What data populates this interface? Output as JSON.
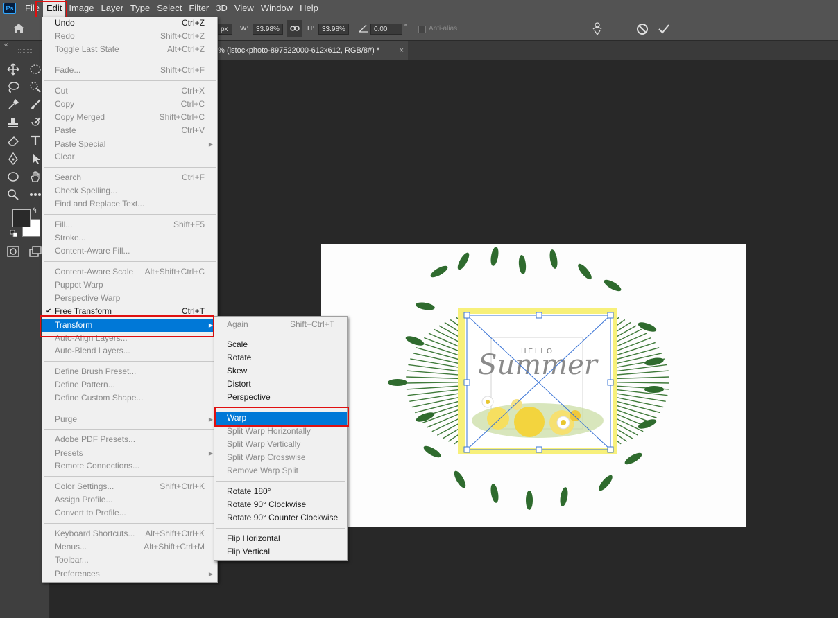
{
  "menubar": {
    "logo": "Ps",
    "items": [
      "File",
      "Edit",
      "Image",
      "Layer",
      "Type",
      "Select",
      "Filter",
      "3D",
      "View",
      "Window",
      "Help"
    ]
  },
  "options": {
    "x_unit": "px",
    "w_label": "W:",
    "w_value": "33.98%",
    "h_label": "H:",
    "h_value": "33.98%",
    "angle_value": "0.00",
    "degree": "°",
    "antialias_label": "Anti-alias"
  },
  "document_tab": {
    "title": "0% (istockphoto-897522000-612x612, RGB/8#) *",
    "close": "×"
  },
  "canvas_image": {
    "hello_text": "HELLO",
    "summer_text": "Summer",
    "frame_color": "#f7f07a"
  },
  "edit_menu": {
    "items": [
      {
        "label": "Undo",
        "shortcut": "Ctrl+Z",
        "disabled": false
      },
      {
        "label": "Redo",
        "shortcut": "Shift+Ctrl+Z",
        "disabled": true
      },
      {
        "label": "Toggle Last State",
        "shortcut": "Alt+Ctrl+Z",
        "disabled": true
      },
      {
        "label": "Fade...",
        "shortcut": "Shift+Ctrl+F",
        "disabled": true
      },
      {
        "label": "Cut",
        "shortcut": "Ctrl+X",
        "disabled": true
      },
      {
        "label": "Copy",
        "shortcut": "Ctrl+C",
        "disabled": true
      },
      {
        "label": "Copy Merged",
        "shortcut": "Shift+Ctrl+C",
        "disabled": true
      },
      {
        "label": "Paste",
        "shortcut": "Ctrl+V",
        "disabled": true
      },
      {
        "label": "Paste Special",
        "shortcut": "",
        "disabled": true,
        "submenu": true
      },
      {
        "label": "Clear",
        "shortcut": "",
        "disabled": true
      },
      {
        "label": "Search",
        "shortcut": "Ctrl+F",
        "disabled": true
      },
      {
        "label": "Check Spelling...",
        "shortcut": "",
        "disabled": true
      },
      {
        "label": "Find and Replace Text...",
        "shortcut": "",
        "disabled": true
      },
      {
        "label": "Fill...",
        "shortcut": "Shift+F5",
        "disabled": true
      },
      {
        "label": "Stroke...",
        "shortcut": "",
        "disabled": true
      },
      {
        "label": "Content-Aware Fill...",
        "shortcut": "",
        "disabled": true
      },
      {
        "label": "Content-Aware Scale",
        "shortcut": "Alt+Shift+Ctrl+C",
        "disabled": true
      },
      {
        "label": "Puppet Warp",
        "shortcut": "",
        "disabled": true
      },
      {
        "label": "Perspective Warp",
        "shortcut": "",
        "disabled": true
      },
      {
        "label": "Free Transform",
        "shortcut": "Ctrl+T",
        "disabled": false,
        "checked": true
      },
      {
        "label": "Transform",
        "shortcut": "",
        "disabled": false,
        "submenu": true,
        "highlighted": true
      },
      {
        "label": "Auto-Align Layers...",
        "shortcut": "",
        "disabled": true
      },
      {
        "label": "Auto-Blend Layers...",
        "shortcut": "",
        "disabled": true
      },
      {
        "label": "Define Brush Preset...",
        "shortcut": "",
        "disabled": true
      },
      {
        "label": "Define Pattern...",
        "shortcut": "",
        "disabled": true
      },
      {
        "label": "Define Custom Shape...",
        "shortcut": "",
        "disabled": true
      },
      {
        "label": "Purge",
        "shortcut": "",
        "disabled": true,
        "submenu": true
      },
      {
        "label": "Adobe PDF Presets...",
        "shortcut": "",
        "disabled": true
      },
      {
        "label": "Presets",
        "shortcut": "",
        "disabled": true,
        "submenu": true
      },
      {
        "label": "Remote Connections...",
        "shortcut": "",
        "disabled": true
      },
      {
        "label": "Color Settings...",
        "shortcut": "Shift+Ctrl+K",
        "disabled": true
      },
      {
        "label": "Assign Profile...",
        "shortcut": "",
        "disabled": true
      },
      {
        "label": "Convert to Profile...",
        "shortcut": "",
        "disabled": true
      },
      {
        "label": "Keyboard Shortcuts...",
        "shortcut": "Alt+Shift+Ctrl+K",
        "disabled": true
      },
      {
        "label": "Menus...",
        "shortcut": "Alt+Shift+Ctrl+M",
        "disabled": true
      },
      {
        "label": "Toolbar...",
        "shortcut": "",
        "disabled": true
      },
      {
        "label": "Preferences",
        "shortcut": "",
        "disabled": true,
        "submenu": true
      }
    ]
  },
  "transform_menu": {
    "items": [
      {
        "label": "Again",
        "shortcut": "Shift+Ctrl+T",
        "disabled": true
      },
      {
        "label": "Scale",
        "shortcut": "",
        "disabled": false
      },
      {
        "label": "Rotate",
        "shortcut": "",
        "disabled": false
      },
      {
        "label": "Skew",
        "shortcut": "",
        "disabled": false
      },
      {
        "label": "Distort",
        "shortcut": "",
        "disabled": false
      },
      {
        "label": "Perspective",
        "shortcut": "",
        "disabled": false
      },
      {
        "label": "Warp",
        "shortcut": "",
        "disabled": false,
        "highlighted": true
      },
      {
        "label": "Split Warp Horizontally",
        "shortcut": "",
        "disabled": true
      },
      {
        "label": "Split Warp Vertically",
        "shortcut": "",
        "disabled": true
      },
      {
        "label": "Split Warp Crosswise",
        "shortcut": "",
        "disabled": true
      },
      {
        "label": "Remove Warp Split",
        "shortcut": "",
        "disabled": true
      },
      {
        "label": "Rotate 180°",
        "shortcut": "",
        "disabled": false
      },
      {
        "label": "Rotate 90° Clockwise",
        "shortcut": "",
        "disabled": false
      },
      {
        "label": "Rotate 90° Counter Clockwise",
        "shortcut": "",
        "disabled": false
      },
      {
        "label": "Flip Horizontal",
        "shortcut": "",
        "disabled": false
      },
      {
        "label": "Flip Vertical",
        "shortcut": "",
        "disabled": false
      }
    ]
  },
  "colors": {
    "highlight": "#0078d7",
    "callout": "#e01010"
  }
}
